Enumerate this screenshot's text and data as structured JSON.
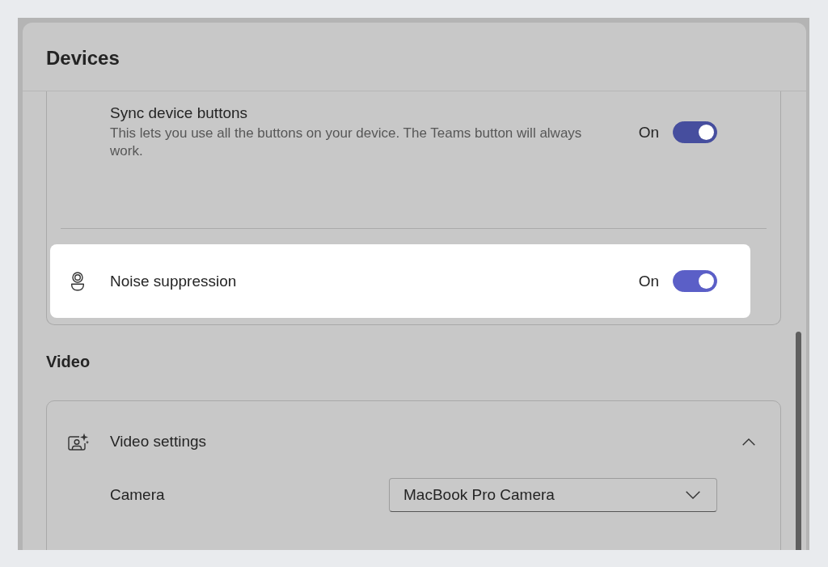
{
  "panel": {
    "title": "Devices"
  },
  "audio_card": {
    "rows": [
      {
        "label": "Sync device buttons",
        "description": "This lets you use all the buttons on your device. The Teams button will always work.",
        "has_icon": false,
        "state_label": "On",
        "on": true,
        "highlighted": false
      },
      {
        "label": "Noise suppression",
        "has_icon": true,
        "state_label": "On",
        "on": true,
        "highlighted": true
      }
    ]
  },
  "video": {
    "heading": "Video",
    "settings": {
      "label": "Video settings",
      "expanded": true,
      "camera": {
        "label": "Camera",
        "value": "MacBook Pro Camera"
      }
    }
  }
}
